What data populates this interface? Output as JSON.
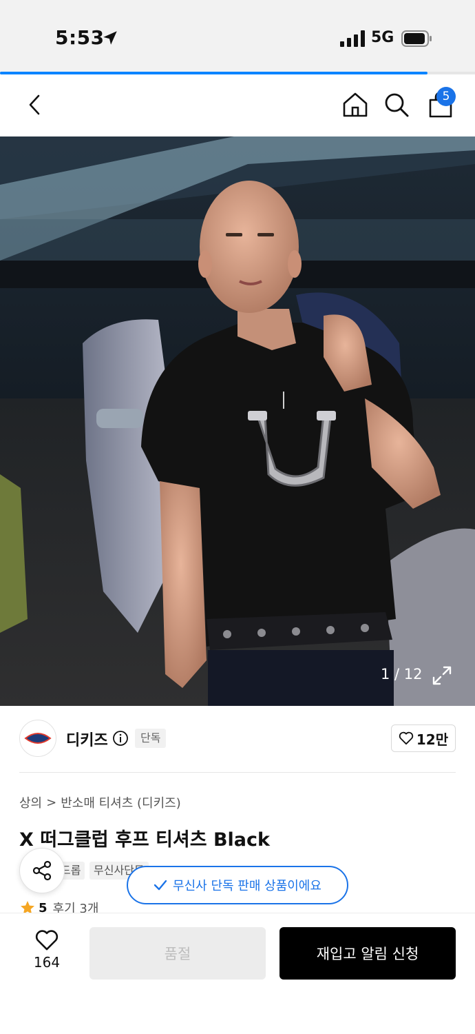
{
  "status_bar": {
    "time": "5:53",
    "network": "5G"
  },
  "page_load_progress": 0.9,
  "nav": {
    "cart_count": "5"
  },
  "gallery": {
    "counter": "1 / 12"
  },
  "brand": {
    "name": "디키즈",
    "exclusive_tag": "단독",
    "likes": "12만"
  },
  "breadcrumb": {
    "category": "상의",
    "separator": ">",
    "subcategory": "반소매 티셔츠 (디키즈)"
  },
  "product": {
    "title": "X 떠그클럽 후프 티셔츠 Black"
  },
  "tags": [
    "드롭",
    "무신사단독"
  ],
  "toast": {
    "message": "무신사 단독 판매 상품이에요"
  },
  "rating": {
    "score": "5",
    "review_label": "후기 3개"
  },
  "bottom_bar": {
    "wish_count": "164",
    "soldout_label": "품절",
    "restock_label": "재입고 알림 신청"
  },
  "colors": {
    "accent": "#1a73e8",
    "primary_button": "#000000",
    "disabled_button": "#ececec",
    "star": "#f5a623"
  }
}
